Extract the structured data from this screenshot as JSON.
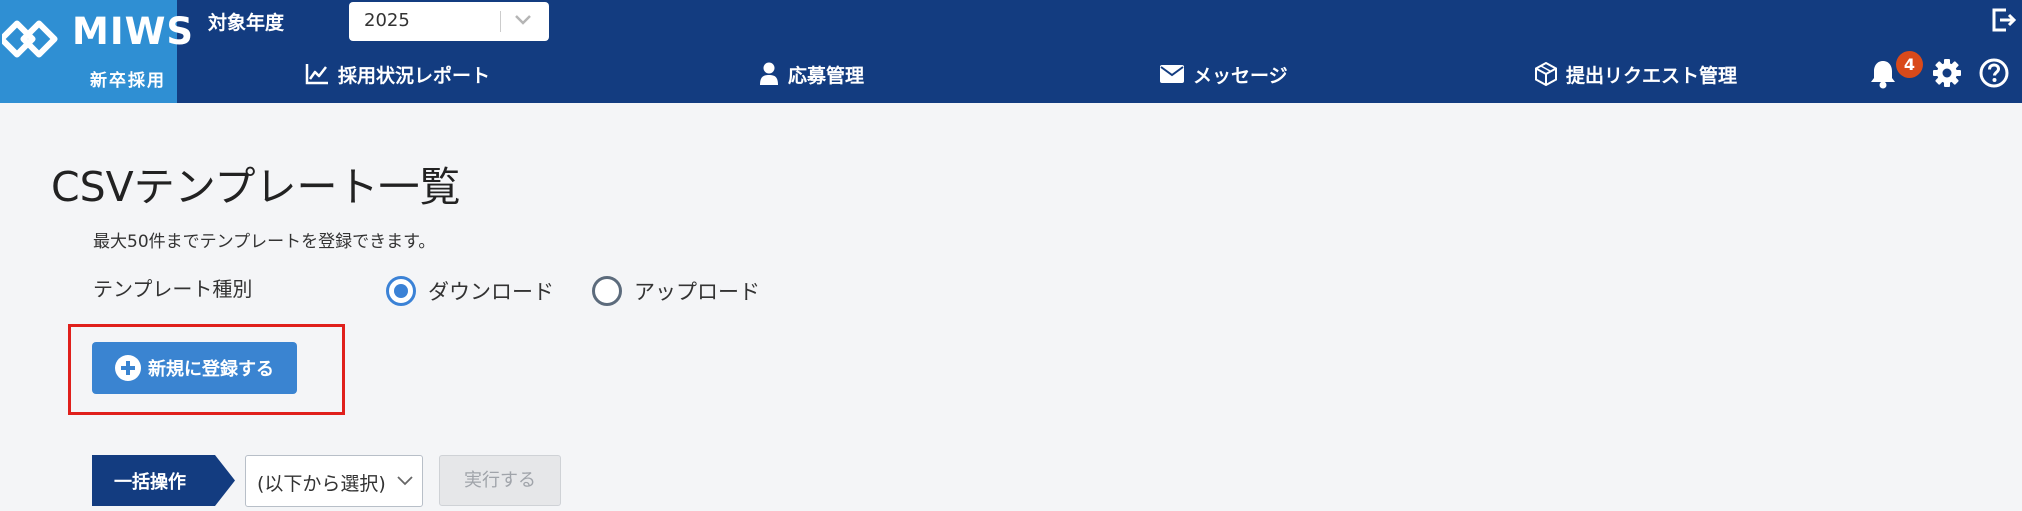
{
  "header": {
    "logo_text": "MIWS",
    "logo_sub": "新卒採用",
    "year_label": "対象年度",
    "year_value": "2025",
    "nav": [
      {
        "label": "採用状況レポート",
        "icon": "chart-line-icon"
      },
      {
        "label": "応募管理",
        "icon": "person-icon"
      },
      {
        "label": "メッセージ",
        "icon": "envelope-icon"
      },
      {
        "label": "提出リクエスト管理",
        "icon": "cube-icon"
      }
    ],
    "notification_count": "4"
  },
  "main": {
    "title": "CSVテンプレート一覧",
    "note": "最大50件までテンプレートを登録できます。",
    "type_label": "テンプレート種別",
    "radio_download": "ダウンロード",
    "radio_upload": "アップロード",
    "selected_type": "ダウンロード",
    "new_button": "新規に登録する",
    "bulk_label": "一括操作",
    "bulk_select_value": "(以下から選択)",
    "execute_button": "実行する"
  },
  "colors": {
    "header_bg": "#133c80",
    "logo_bg": "#2f8fd3",
    "primary_button": "#3a84d1",
    "badge": "#d94a1a",
    "highlight": "#e0201c"
  }
}
